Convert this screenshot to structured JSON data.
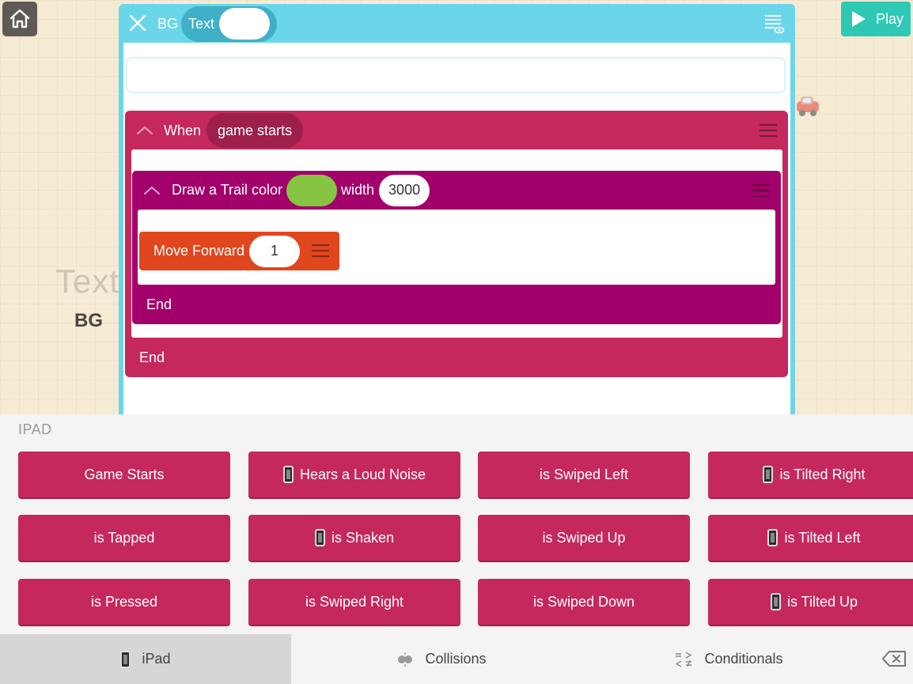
{
  "stage": {
    "text_label": "Text",
    "bg_label": "BG",
    "play_label": "Play"
  },
  "editor": {
    "header_bg": "BG",
    "header_pill_label": "Text",
    "search_placeholder": ""
  },
  "when_block": {
    "keyword": "When",
    "event": "game starts",
    "end": "End"
  },
  "trail_block": {
    "label": "Draw a Trail color",
    "color": "#86c441",
    "width_label": "width",
    "width_value": "3000",
    "end": "End"
  },
  "move_block": {
    "label": "Move Forward",
    "value": "1"
  },
  "palette": {
    "title": "IPAD",
    "rows": [
      [
        {
          "label": "Game Starts",
          "icon": ""
        },
        {
          "label": "Hears a Loud Noise",
          "icon": "phone-icon"
        },
        {
          "label": "is Swiped Left",
          "icon": ""
        },
        {
          "label": "is Tilted Right",
          "icon": "phone-icon"
        }
      ],
      [
        {
          "label": "is Tapped",
          "icon": ""
        },
        {
          "label": "is Shaken",
          "icon": "phone-icon"
        },
        {
          "label": "is Swiped Up",
          "icon": ""
        },
        {
          "label": "is Tilted Left",
          "icon": "phone-icon"
        }
      ],
      [
        {
          "label": "is Pressed",
          "icon": ""
        },
        {
          "label": "is Swiped Right",
          "icon": ""
        },
        {
          "label": "is Swiped Down",
          "icon": ""
        },
        {
          "label": "is Tilted Up",
          "icon": "phone-icon"
        }
      ]
    ]
  },
  "tabs": {
    "ipad": "iPad",
    "collisions": "Collisions",
    "conditionals": "Conditionals"
  },
  "colors": {
    "editor_frame": "#6bd6ea",
    "when_block": "#c4285d",
    "trail_block": "#a2006a",
    "move_block": "#e0471f",
    "play_button": "#2ec9b4"
  }
}
